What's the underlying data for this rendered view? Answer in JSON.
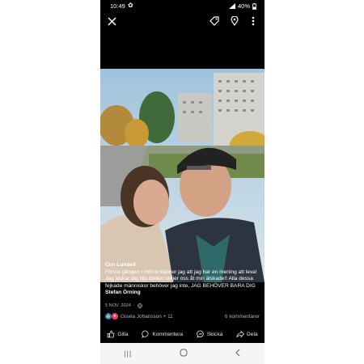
{
  "status_bar": {
    "time": "10:49",
    "battery": "40%"
  },
  "photo_icons": [
    "close-icon",
    "tag-icon",
    "location-pin-icon",
    "more-vertical-icon"
  ],
  "post": {
    "author": "Cim Lundell",
    "caption": "Första gången i mitt liv känner jag att jag har en mening att leva! Jag älskar dig tills döden skiljer oss åt min älskade!! Alla dessa fejkade människor behöver jag inte, JAG BEHÖVER BARA DIG",
    "tagged": "Stefan Örning",
    "date": "5 NOV. 2024",
    "reactions_text": "Gisela Johansson + 11",
    "comments_text": "6 kommentarer"
  },
  "actions": {
    "like": "Gilla",
    "comment": "Kommentera",
    "send": "Skicka",
    "share": "Dela"
  },
  "colors": {
    "like_blue": "#1877f2",
    "love_red": "#f33e58",
    "background": "#000000"
  }
}
